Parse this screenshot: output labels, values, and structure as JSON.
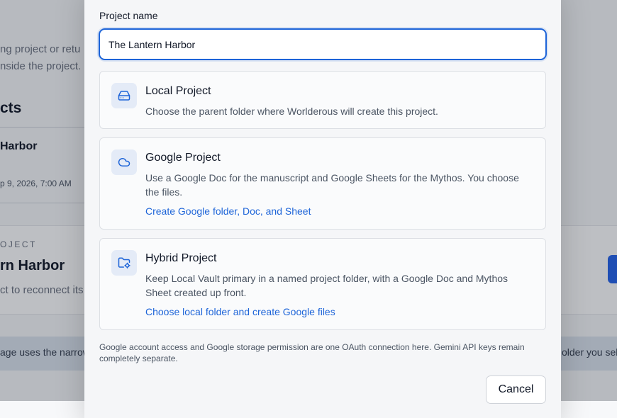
{
  "background": {
    "intro_line1": "ng project or retu",
    "intro_line2": "nside the project.",
    "section_heading": "cts",
    "recent_project": {
      "title": "Harbor",
      "date": "p 9, 2026, 7:00 AM"
    },
    "current_project": {
      "eyebrow": "OJECT",
      "title": "rn Harbor",
      "subtitle": "ct to reconnect its s"
    },
    "notice": {
      "left_text": "age uses the narrow",
      "right_text": "older you sele"
    }
  },
  "dialog": {
    "project_name_label": "Project name",
    "project_name_value": "The Lantern Harbor",
    "options": [
      {
        "title": "Local Project",
        "description": "Choose the parent folder where Worlderous will create this project.",
        "icon": "hard-drive-icon"
      },
      {
        "title": "Google Project",
        "description": "Use a Google Doc for the manuscript and Google Sheets for the Mythos. You choose the files.",
        "link": "Create Google folder, Doc, and Sheet",
        "icon": "cloud-icon"
      },
      {
        "title": "Hybrid Project",
        "description": "Keep Local Vault primary in a named project folder, with a Google Doc and Mythos Sheet created up front.",
        "link": "Choose local folder and create Google files",
        "icon": "folder-settings-icon"
      }
    ],
    "footnote": "Google account access and Google storage permission are one OAuth connection here. Gemini API keys remain completely separate.",
    "cancel_label": "Cancel"
  },
  "colors": {
    "accent": "#1d64d8",
    "icon_tile": "#e4ebf7",
    "overlay": "rgba(17,24,39,0.28)"
  }
}
